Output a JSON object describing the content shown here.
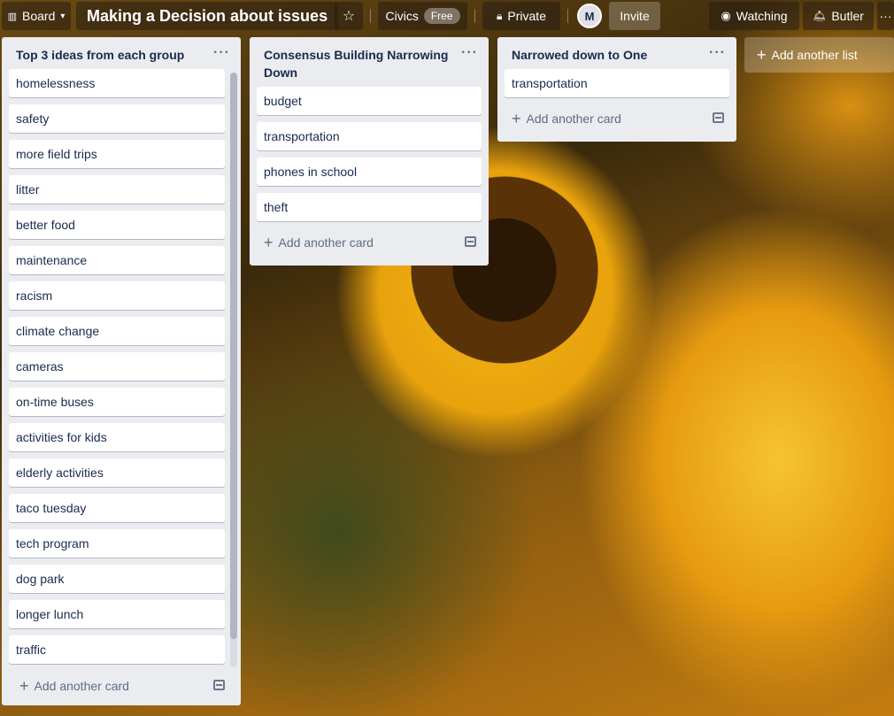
{
  "topbar": {
    "board_switcher": "Board",
    "board_title": "Making a Decision about issues",
    "team_name": "Civics",
    "team_plan": "Free",
    "visibility": "Private",
    "avatar_initial": "M",
    "invite": "Invite",
    "watching": "Watching",
    "butler": "Butler"
  },
  "lists": [
    {
      "title": "Top 3 ideas from each group",
      "cards": [
        "homelessness",
        "safety",
        "more field trips",
        "litter",
        "better food",
        "maintenance",
        "racism",
        "climate change",
        "cameras",
        "on-time buses",
        "activities for kids",
        "elderly activities",
        "taco tuesday",
        "tech program",
        "dog park",
        "longer lunch",
        "traffic"
      ],
      "add_card": "Add another card"
    },
    {
      "title": "Consensus Building Narrowing Down",
      "cards": [
        "budget",
        "transportation",
        "phones in school",
        "theft"
      ],
      "add_card": "Add another card"
    },
    {
      "title": "Narrowed down to One",
      "cards": [
        "transportation"
      ],
      "add_card": "Add another card"
    }
  ],
  "add_list": "Add another list",
  "colors": {
    "list_bg": "#ebecf0",
    "card_text": "#172b4d",
    "muted_text": "#5e6c84"
  }
}
